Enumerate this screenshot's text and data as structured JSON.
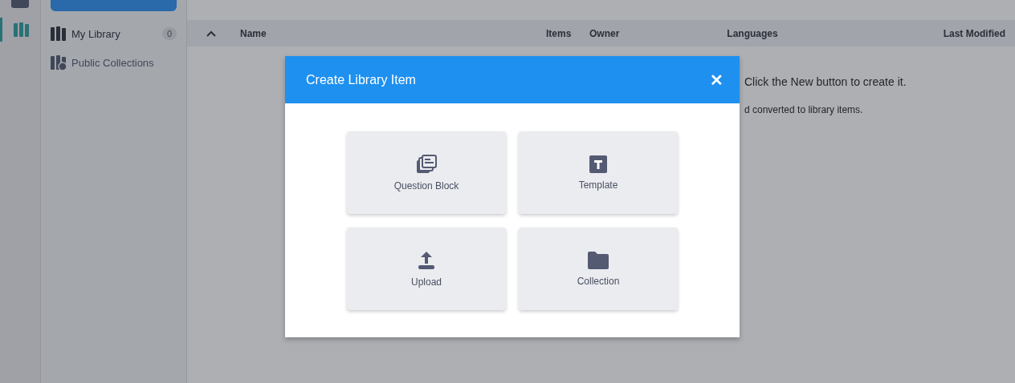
{
  "sidebar": {
    "items": [
      {
        "label": "My Library",
        "count": "0",
        "selected": true
      },
      {
        "label": "Public Collections",
        "selected": false
      }
    ]
  },
  "table": {
    "columns": [
      "Name",
      "Items",
      "Owner",
      "Languages",
      "Last Modified"
    ]
  },
  "empty_message": [
    "Click the New button to create it.",
    "d converted to library items."
  ],
  "dialog": {
    "title": "Create Library Item",
    "close": "✕",
    "options": [
      {
        "kind": "question-block",
        "label": "Question Block"
      },
      {
        "kind": "template",
        "label": "Template"
      },
      {
        "kind": "upload",
        "label": "Upload"
      },
      {
        "kind": "collection",
        "label": "Collection"
      }
    ]
  }
}
